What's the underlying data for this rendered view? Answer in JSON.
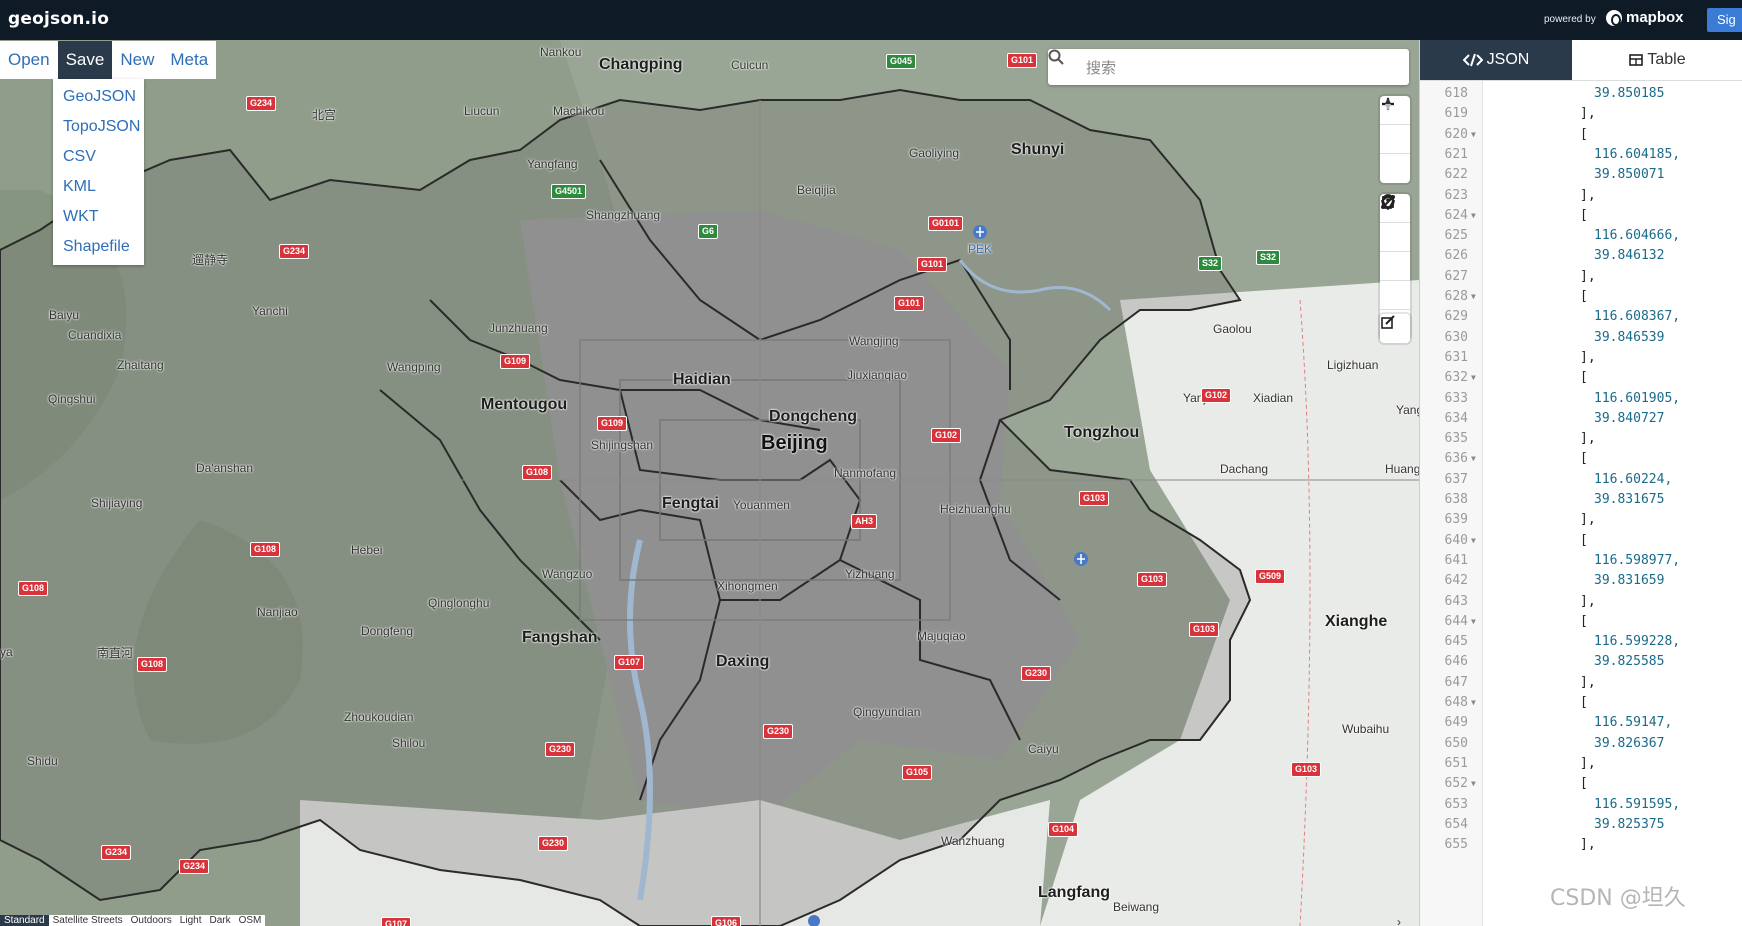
{
  "app": {
    "brand": "geojson.io",
    "powered_by": "powered by",
    "mapbox": "mapbox",
    "signin": "Sig"
  },
  "menu": {
    "items": [
      "Open",
      "Save",
      "New",
      "Meta"
    ],
    "active": "Save",
    "save_options": [
      "GeoJSON",
      "TopoJSON",
      "CSV",
      "KML",
      "WKT",
      "Shapefile"
    ],
    "highlight_color": "#ff6a00"
  },
  "search": {
    "placeholder": "搜索"
  },
  "map_labels": {
    "districts": [
      "Changping",
      "Shunyi",
      "Haidian",
      "Dongcheng",
      "Beijing",
      "Fengtai",
      "Tongzhou",
      "Fangshan",
      "Daxing",
      "Mentougou",
      "Xianghe",
      "Langfang"
    ],
    "places": [
      "Nankou",
      "Cuicun",
      "北宫",
      "Liucun",
      "Machikou",
      "Yangfang",
      "Shangzhuang",
      "Beiqijia",
      "Gaoliying",
      "PEK",
      "Gaolou",
      "Ligizhuan",
      "Yanjiao",
      "Xiadian",
      "Yang",
      "Dachang",
      "Huang",
      "遛静寺",
      "Baiyu",
      "Cuandixia",
      "Yanchi",
      "Junzhuang",
      "Zhaitang",
      "Wangping",
      "Qingshui",
      "Wangjing",
      "Jiuxianqiao",
      "Shijingshan",
      "Nanmofang",
      "Youanmen",
      "Heizhuanghu",
      "Da'anshan",
      "Shijiaying",
      "Hebei",
      "Wangzuo",
      "Xihongmen",
      "Yizhuang",
      "Nanjiao",
      "Qinglonghu",
      "Dongfeng",
      "南直河",
      "Majuqiao",
      "Zhoukoudian",
      "Qingyundian",
      "Shilou",
      "Shidu",
      "Caiyu",
      "Wubaihu",
      "Wanzhuang",
      "Beiwang",
      "ya"
    ],
    "shields": [
      "G234",
      "G045",
      "G101",
      "G4501",
      "G6",
      "G0101",
      "G101",
      "G101",
      "S32",
      "S32",
      "G234",
      "G109",
      "G109",
      "G102",
      "G102",
      "G108",
      "G108",
      "G108",
      "G103",
      "G103",
      "G509",
      "G103",
      "AH3",
      "G107",
      "G108",
      "G230",
      "G230",
      "G230",
      "G105",
      "G104",
      "G230",
      "G234",
      "G234",
      "G107",
      "G106",
      "G103"
    ]
  },
  "layers": [
    "Standard",
    "Satellite Streets",
    "Outdoors",
    "Light",
    "Dark",
    "OSM"
  ],
  "active_layer": "Standard",
  "panel": {
    "tabs": [
      {
        "icon": "code-icon",
        "label": "JSON",
        "active": true
      },
      {
        "icon": "table-icon",
        "label": "Table",
        "active": false
      }
    ],
    "code_lines": [
      {
        "n": "618",
        "fold": false,
        "text": "39.850185",
        "indent": 2
      },
      {
        "n": "619",
        "fold": false,
        "text": "],",
        "indent": 1
      },
      {
        "n": "620",
        "fold": true,
        "text": "[",
        "indent": 1
      },
      {
        "n": "621",
        "fold": false,
        "text": "116.604185,",
        "indent": 2
      },
      {
        "n": "622",
        "fold": false,
        "text": "39.850071",
        "indent": 2
      },
      {
        "n": "623",
        "fold": false,
        "text": "],",
        "indent": 1
      },
      {
        "n": "624",
        "fold": true,
        "text": "[",
        "indent": 1
      },
      {
        "n": "625",
        "fold": false,
        "text": "116.604666,",
        "indent": 2
      },
      {
        "n": "626",
        "fold": false,
        "text": "39.846132",
        "indent": 2
      },
      {
        "n": "627",
        "fold": false,
        "text": "],",
        "indent": 1
      },
      {
        "n": "628",
        "fold": true,
        "text": "[",
        "indent": 1
      },
      {
        "n": "629",
        "fold": false,
        "text": "116.608367,",
        "indent": 2
      },
      {
        "n": "630",
        "fold": false,
        "text": "39.846539",
        "indent": 2
      },
      {
        "n": "631",
        "fold": false,
        "text": "],",
        "indent": 1
      },
      {
        "n": "632",
        "fold": true,
        "text": "[",
        "indent": 1
      },
      {
        "n": "633",
        "fold": false,
        "text": "116.601905,",
        "indent": 2
      },
      {
        "n": "634",
        "fold": false,
        "text": "39.840727",
        "indent": 2
      },
      {
        "n": "635",
        "fold": false,
        "text": "],",
        "indent": 1
      },
      {
        "n": "636",
        "fold": true,
        "text": "[",
        "indent": 1
      },
      {
        "n": "637",
        "fold": false,
        "text": "116.60224,",
        "indent": 2
      },
      {
        "n": "638",
        "fold": false,
        "text": "39.831675",
        "indent": 2
      },
      {
        "n": "639",
        "fold": false,
        "text": "],",
        "indent": 1
      },
      {
        "n": "640",
        "fold": true,
        "text": "[",
        "indent": 1
      },
      {
        "n": "641",
        "fold": false,
        "text": "116.598977,",
        "indent": 2
      },
      {
        "n": "642",
        "fold": false,
        "text": "39.831659",
        "indent": 2
      },
      {
        "n": "643",
        "fold": false,
        "text": "],",
        "indent": 1
      },
      {
        "n": "644",
        "fold": true,
        "text": "[",
        "indent": 1
      },
      {
        "n": "645",
        "fold": false,
        "text": "116.599228,",
        "indent": 2
      },
      {
        "n": "646",
        "fold": false,
        "text": "39.825585",
        "indent": 2
      },
      {
        "n": "647",
        "fold": false,
        "text": "],",
        "indent": 1
      },
      {
        "n": "648",
        "fold": true,
        "text": "[",
        "indent": 1
      },
      {
        "n": "649",
        "fold": false,
        "text": "116.59147,",
        "indent": 2
      },
      {
        "n": "650",
        "fold": false,
        "text": "39.826367",
        "indent": 2
      },
      {
        "n": "651",
        "fold": false,
        "text": "],",
        "indent": 1
      },
      {
        "n": "652",
        "fold": true,
        "text": "[",
        "indent": 1
      },
      {
        "n": "653",
        "fold": false,
        "text": "116.591595,",
        "indent": 2
      },
      {
        "n": "654",
        "fold": false,
        "text": "39.825375",
        "indent": 2
      },
      {
        "n": "655",
        "fold": false,
        "text": "],",
        "indent": 1
      }
    ]
  },
  "watermark": "CSDN @坦久",
  "colors": {
    "topbar": "#0e1a26",
    "active": "#2b3a4a",
    "link": "#2f6fb5",
    "shield": "#d8333a"
  }
}
